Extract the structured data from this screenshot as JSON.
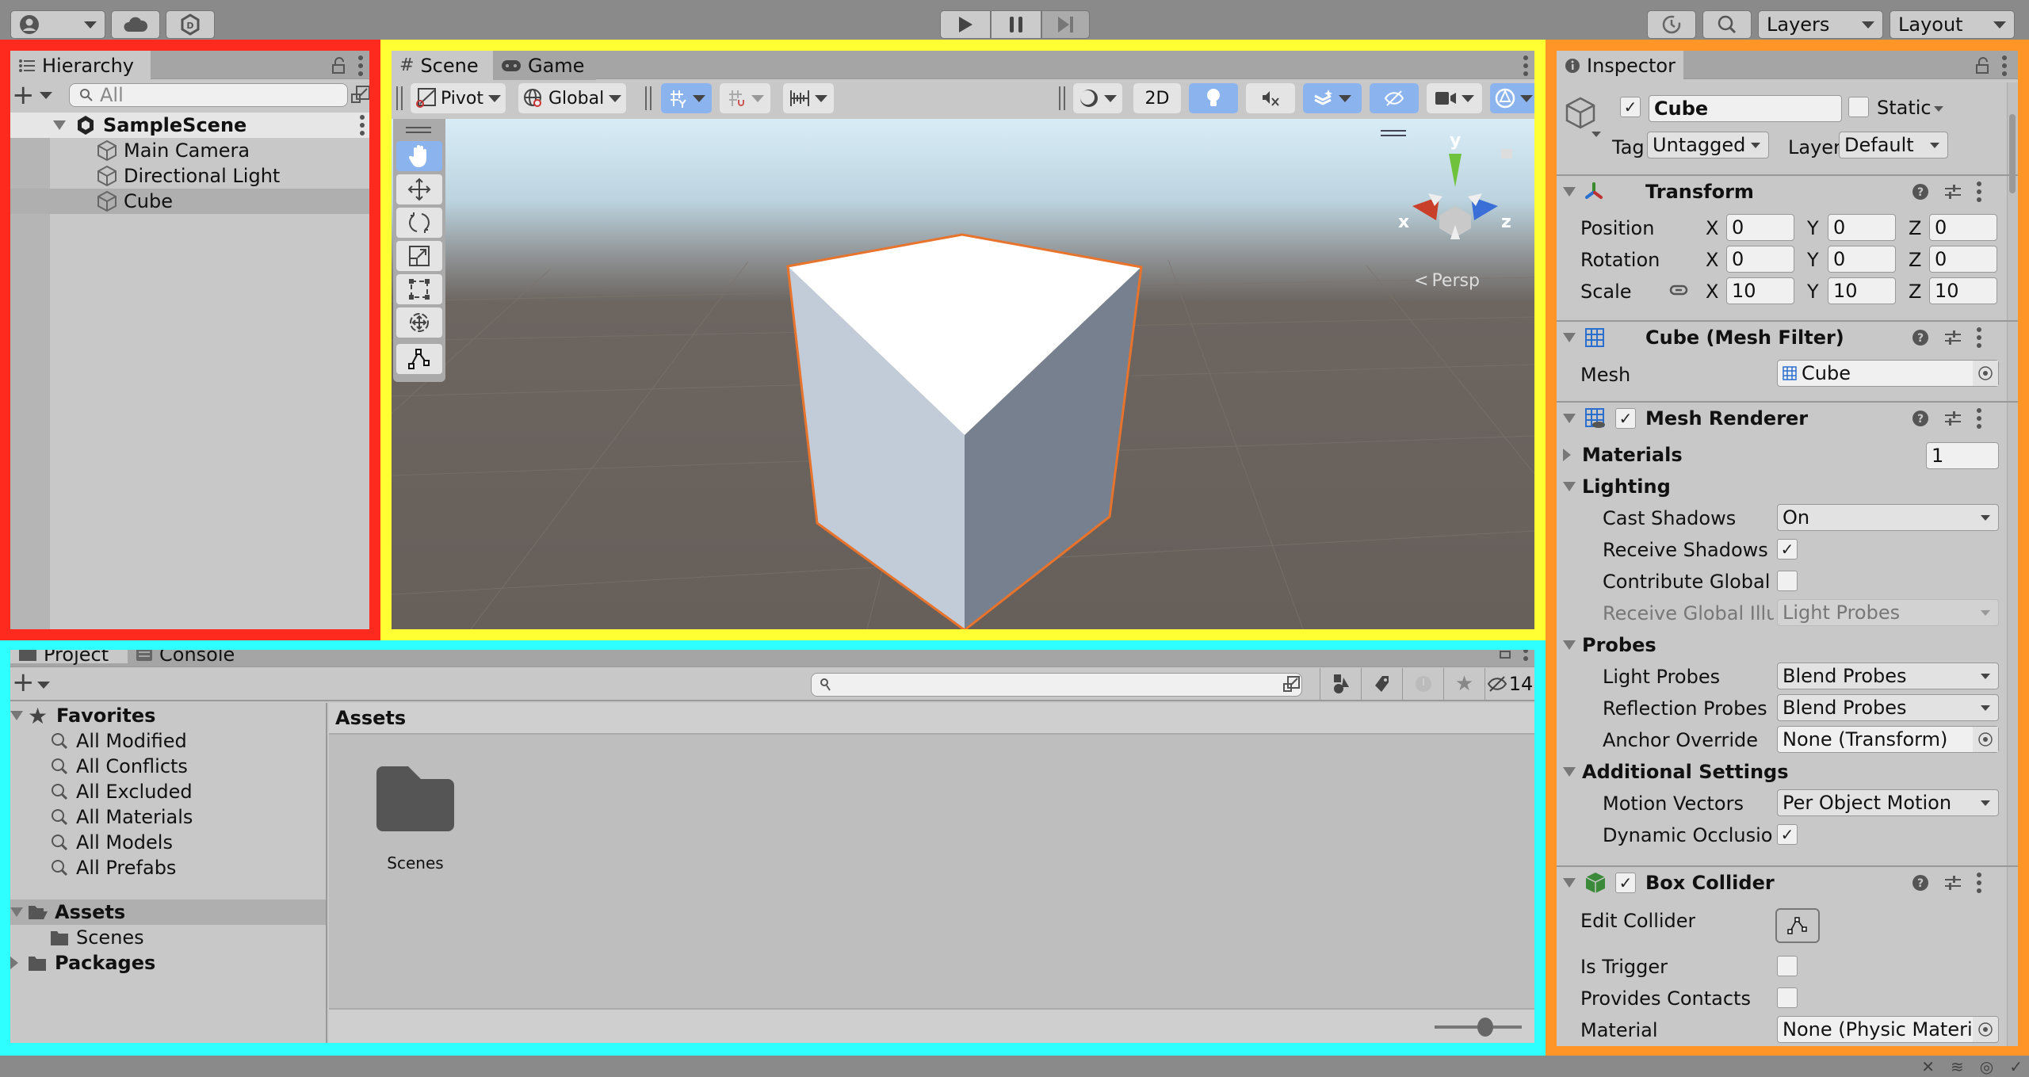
{
  "topbar": {
    "account_icon": "account-icon",
    "cloud_icon": "cloud-icon",
    "plastic_icon": "version-control-icon",
    "play_icon": "play-icon",
    "pause_icon": "pause-icon",
    "step_icon": "step-icon",
    "history_icon": "history-icon",
    "search_icon": "search-icon",
    "layers_label": "Layers",
    "layout_label": "Layout"
  },
  "hierarchy": {
    "tab_label": "Hierarchy",
    "search_placeholder": "All",
    "scene_name": "SampleScene",
    "items": [
      {
        "label": "Main Camera",
        "selected": false
      },
      {
        "label": "Directional Light",
        "selected": false
      },
      {
        "label": "Cube",
        "selected": true
      }
    ]
  },
  "scene": {
    "tabs": [
      {
        "label": "Scene",
        "icon": "grid-hash-icon",
        "active": true
      },
      {
        "label": "Game",
        "icon": "gamepad-icon",
        "active": false
      }
    ],
    "toolbar": {
      "pivot_label": "Pivot",
      "global_label": "Global",
      "twod_label": "2D"
    },
    "tools": [
      "hand-tool",
      "move-tool",
      "rotate-tool",
      "scale-tool",
      "rect-tool",
      "transform-tool",
      "edit-collider-tool"
    ],
    "gizmo": {
      "x_label": "x",
      "y_label": "y",
      "z_label": "z",
      "persp_label": "Persp"
    },
    "colors": {
      "selection_outline": "#e8732c",
      "gizmo_x": "#c8402a",
      "gizmo_y": "#6fc23c",
      "gizmo_z": "#3a6fd8"
    }
  },
  "project": {
    "tabs": [
      {
        "label": "Project",
        "active": true
      },
      {
        "label": "Console",
        "active": false
      }
    ],
    "search_value": "",
    "hidden_count": "14",
    "favorites_label": "Favorites",
    "favorites": [
      "All Modified",
      "All Conflicts",
      "All Excluded",
      "All Materials",
      "All Models",
      "All Prefabs"
    ],
    "assets_label": "Assets",
    "assets_children": [
      "Scenes"
    ],
    "packages_label": "Packages",
    "breadcrumb": "Assets",
    "grid_items": [
      {
        "label": "Scenes",
        "icon": "folder-icon"
      }
    ],
    "zoom_slider_value": 0.6
  },
  "inspector": {
    "tab_label": "Inspector",
    "object": {
      "active": true,
      "name": "Cube",
      "static_label": "Static",
      "static": false,
      "tag_label": "Tag",
      "tag_value": "Untagged",
      "layer_label": "Layer",
      "layer_value": "Default"
    },
    "transform": {
      "title": "Transform",
      "rows": [
        {
          "label": "Position",
          "x": "0",
          "y": "0",
          "z": "0"
        },
        {
          "label": "Rotation",
          "x": "0",
          "y": "0",
          "z": "0"
        },
        {
          "label": "Scale",
          "x": "10",
          "y": "10",
          "z": "10"
        }
      ],
      "axis_x": "X",
      "axis_y": "Y",
      "axis_z": "Z"
    },
    "mesh_filter": {
      "title": "Cube (Mesh Filter)",
      "mesh_label": "Mesh",
      "mesh_value": "Cube"
    },
    "mesh_renderer": {
      "title": "Mesh Renderer",
      "enabled": true,
      "materials_label": "Materials",
      "materials_count": "1",
      "lighting_label": "Lighting",
      "cast_shadows_label": "Cast Shadows",
      "cast_shadows_value": "On",
      "receive_shadows_label": "Receive Shadows",
      "receive_shadows": true,
      "contribute_gi_label": "Contribute Global I",
      "contribute_gi": false,
      "receive_gi_label": "Receive Global Illu",
      "receive_gi_value": "Light Probes",
      "probes_label": "Probes",
      "light_probes_label": "Light Probes",
      "light_probes_value": "Blend Probes",
      "reflection_probes_label": "Reflection Probes",
      "reflection_probes_value": "Blend Probes",
      "anchor_override_label": "Anchor Override",
      "anchor_override_value": "None (Transform)",
      "additional_label": "Additional Settings",
      "motion_vectors_label": "Motion Vectors",
      "motion_vectors_value": "Per Object Motion",
      "dynamic_occlusion_label": "Dynamic Occlusio",
      "dynamic_occlusion": true
    },
    "box_collider": {
      "title": "Box Collider",
      "enabled": true,
      "edit_collider_label": "Edit Collider",
      "is_trigger_label": "Is Trigger",
      "is_trigger": false,
      "provides_contacts_label": "Provides Contacts",
      "provides_contacts": false,
      "material_label": "Material",
      "material_value": "None (Physic Material"
    }
  },
  "frames": {
    "hierarchy": "#ff2a1e",
    "scene": "#ffff33",
    "project": "#2effff",
    "inspector": "#ff9526"
  }
}
